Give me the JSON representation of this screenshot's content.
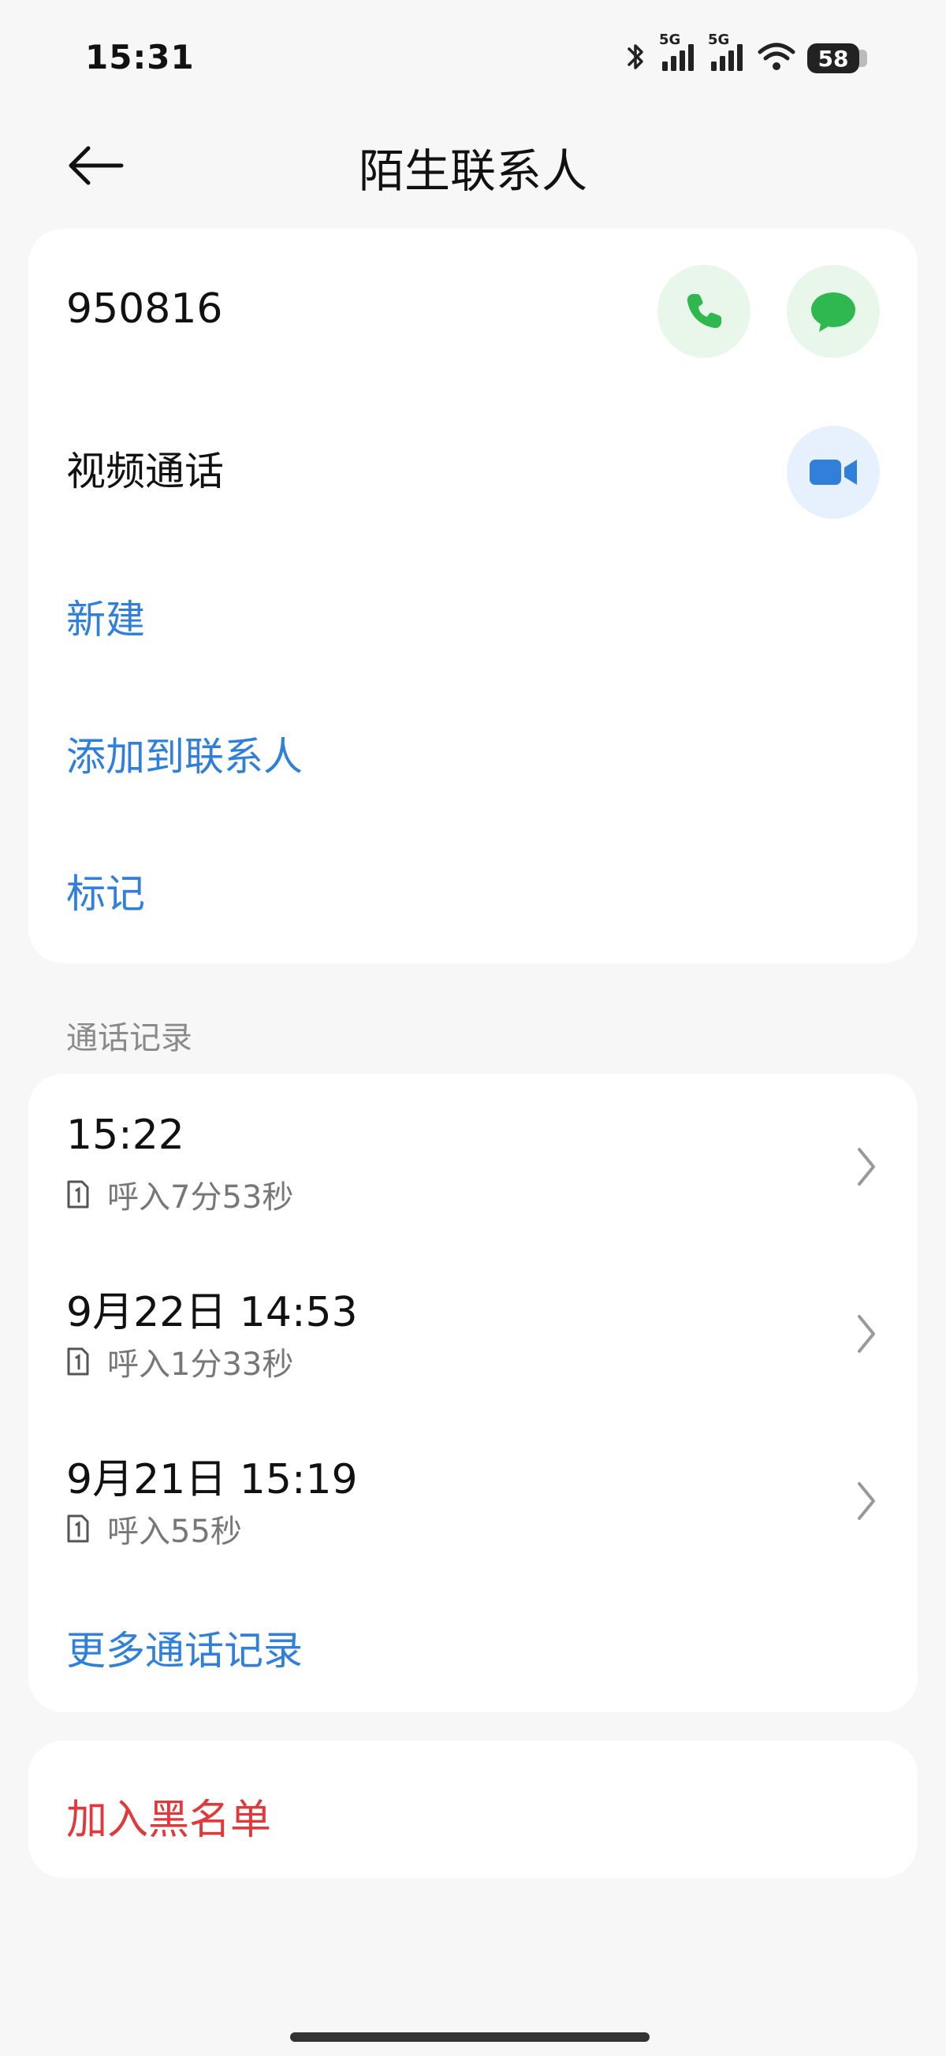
{
  "status_bar": {
    "time": "15:31",
    "network_1": "5G",
    "network_2": "5G",
    "battery": "58"
  },
  "header": {
    "title": "陌生联系人"
  },
  "contact": {
    "number": "950816",
    "video_call_label": "视频通话",
    "new_label": "新建",
    "add_to_contacts_label": "添加到联系人",
    "mark_label": "标记"
  },
  "call_log": {
    "heading": "通话记录",
    "items": [
      {
        "time": "15:22",
        "detail": "呼入7分53秒"
      },
      {
        "time": "9月22日 14:53",
        "detail": "呼入1分33秒"
      },
      {
        "time": "9月21日 15:19",
        "detail": "呼入55秒"
      }
    ],
    "more_label": "更多通话记录"
  },
  "block": {
    "label": "加入黑名单"
  },
  "colors": {
    "accent_blue": "#2f7fdb",
    "call_green": "#2fb84f",
    "video_blue": "#2f7fdb",
    "danger_red": "#e0383b"
  },
  "icons": {
    "back": "arrow-left-icon",
    "call": "phone-icon",
    "message": "chat-bubble-icon",
    "video": "video-camera-icon",
    "sim": "sim-card-1-icon",
    "chevron": "chevron-right-icon",
    "bluetooth": "bluetooth-icon",
    "signal": "cell-signal-icon",
    "wifi": "wifi-icon",
    "battery": "battery-icon"
  }
}
